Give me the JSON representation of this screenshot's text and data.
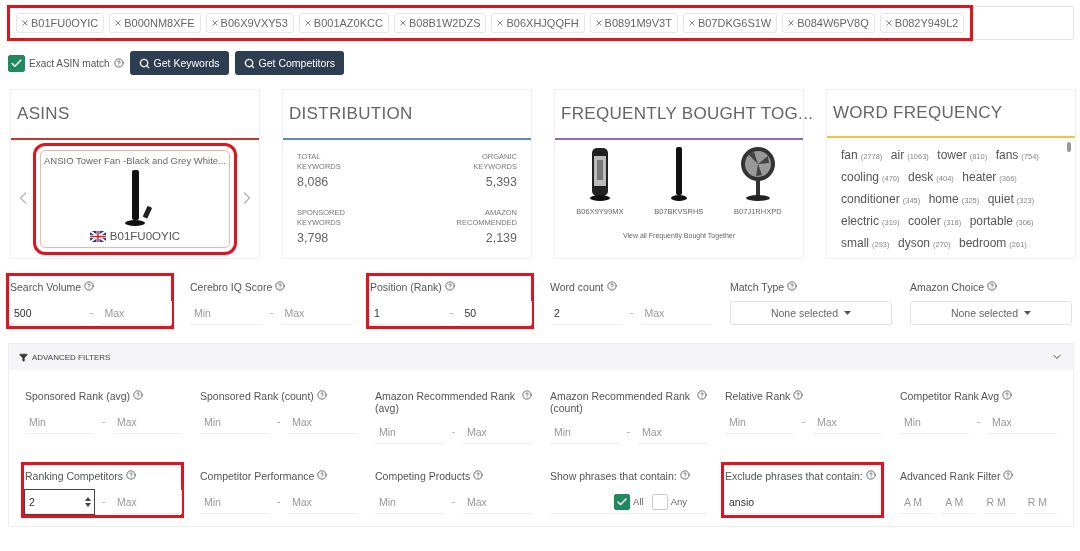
{
  "asin_tags": {
    "highlighted": true,
    "tags": [
      "B01FU0OYIC",
      "B000NM8XFE",
      "B06X9VXY53",
      "B001AZ0KCC",
      "B08B1W2DZS",
      "B06XHJQQFH",
      "B0891M9V3T",
      "B07DKG6S1W",
      "B084W6PV8Q",
      "B082Y949L2"
    ]
  },
  "exact_match": {
    "label": "Exact ASIN match",
    "checked": true
  },
  "buttons": [
    "Get Keywords",
    "Get Competitors"
  ],
  "cards": [
    {
      "kind": "asins",
      "title": "ASINS",
      "color": "#c0392b",
      "product": {
        "name": "ANSIO Tower Fan -Black and Grey White...",
        "asin": "B01FU0OYIC",
        "highlighted": true
      }
    },
    {
      "kind": "distribution",
      "title": "DISTRIBUTION",
      "color": "#5b8db8",
      "stats": [
        {
          "label": "TOTAL KEYWORDS",
          "value": "8,086"
        },
        {
          "label": "ORGANIC KEYWORDS",
          "value": "5,393"
        },
        {
          "label": "SPONSORED KEYWORDS",
          "value": "3,798"
        },
        {
          "label": "AMAZON RECOMMENDED",
          "value": "2,139"
        }
      ]
    },
    {
      "kind": "bought",
      "title": "FREQUENTLY BOUGHT TOG...",
      "color": "#8e6bb5",
      "products": [
        {
          "asin": "B06X9Y99MX",
          "kind": "heater"
        },
        {
          "asin": "B07BKVSRHS",
          "kind": "tower"
        },
        {
          "asin": "B07J1RHXPD",
          "kind": "desk-fan"
        }
      ],
      "link": "View all Frequently Bought Together"
    },
    {
      "kind": "words",
      "title": "WORD FREQUENCY",
      "color": "#f0c43c",
      "words": [
        {
          "word": "fan",
          "count": "(2778)"
        },
        {
          "word": "air",
          "count": "(1063)"
        },
        {
          "word": "tower",
          "count": "(810)"
        },
        {
          "word": "fans",
          "count": "(754)"
        },
        {
          "word": "cooling",
          "count": "(470)"
        },
        {
          "word": "desk",
          "count": "(404)"
        },
        {
          "word": "heater",
          "count": "(366)"
        },
        {
          "word": "conditioner",
          "count": "(345)"
        },
        {
          "word": "home",
          "count": "(325)"
        },
        {
          "word": "quiet",
          "count": "(323)"
        },
        {
          "word": "electric",
          "count": "(319)"
        },
        {
          "word": "cooler",
          "count": "(318)"
        },
        {
          "word": "portable",
          "count": "(306)"
        },
        {
          "word": "small",
          "count": "(293)"
        },
        {
          "word": "dyson",
          "count": "(270)"
        },
        {
          "word": "bedroom",
          "count": "(261)"
        }
      ]
    }
  ],
  "filters": [
    {
      "kind": "range",
      "label": "Search Volume",
      "highlighted": true,
      "inputs": [
        {
          "value": "500"
        },
        {
          "placeholder": "Max"
        }
      ]
    },
    {
      "kind": "range",
      "label": "Cerebro IQ Score",
      "highlighted": false,
      "inputs": [
        {
          "placeholder": "Min"
        },
        {
          "placeholder": "Max"
        }
      ]
    },
    {
      "kind": "range",
      "label": "Position (Rank)",
      "highlighted": true,
      "inputs": [
        {
          "value": "1"
        },
        {
          "value": "50"
        }
      ]
    },
    {
      "kind": "range",
      "label": "Word count",
      "highlighted": false,
      "inputs": [
        {
          "value": "2"
        },
        {
          "placeholder": "Max"
        }
      ]
    },
    {
      "kind": "select",
      "label": "Match Type",
      "highlighted": false,
      "value": "None selected"
    },
    {
      "kind": "select",
      "label": "Amazon Choice",
      "highlighted": false,
      "value": "None selected"
    }
  ],
  "advanced": {
    "label": "ADVANCED FILTERS",
    "expanded": true,
    "filters": [
      {
        "kind": "range",
        "label": "Sponsored Rank (avg)",
        "highlighted": false,
        "inputs": [
          {
            "placeholder": "Min"
          },
          {
            "placeholder": "Max"
          }
        ]
      },
      {
        "kind": "range",
        "label": "Sponsored Rank (count)",
        "highlighted": false,
        "inputs": [
          {
            "placeholder": "Min"
          },
          {
            "placeholder": "Max"
          }
        ]
      },
      {
        "kind": "range",
        "label": "Amazon Recommended Rank (avg)",
        "highlighted": false,
        "inputs": [
          {
            "placeholder": "Min"
          },
          {
            "placeholder": "Max"
          }
        ]
      },
      {
        "kind": "range",
        "label": "Amazon Recommended Rank (count)",
        "highlighted": false,
        "inputs": [
          {
            "placeholder": "Min"
          },
          {
            "placeholder": "Max"
          }
        ]
      },
      {
        "kind": "range",
        "label": "Relative Rank",
        "highlighted": false,
        "inputs": [
          {
            "placeholder": "Min"
          },
          {
            "placeholder": "Max"
          }
        ]
      },
      {
        "kind": "range",
        "label": "Competitor Rank Avg",
        "highlighted": false,
        "inputs": [
          {
            "placeholder": "Min"
          },
          {
            "placeholder": "Max"
          }
        ]
      },
      {
        "kind": "range",
        "label": "Ranking Competitors",
        "highlighted": true,
        "inputs": [
          {
            "value": "2",
            "spinner": true
          },
          {
            "placeholder": "Max"
          }
        ]
      },
      {
        "kind": "range",
        "label": "Competitor Performance",
        "highlighted": false,
        "inputs": [
          {
            "placeholder": "Min"
          },
          {
            "placeholder": "Max"
          }
        ]
      },
      {
        "kind": "range",
        "label": "Competing Products",
        "highlighted": false,
        "inputs": [
          {
            "placeholder": "Min"
          },
          {
            "placeholder": "Max"
          }
        ]
      },
      {
        "kind": "checks",
        "label": "Show phrases that contain:",
        "highlighted": false,
        "options": [
          {
            "label": "All",
            "checked": true
          },
          {
            "label": "Any",
            "checked": false
          }
        ]
      },
      {
        "kind": "text",
        "label": "Exclude phrases that contain:",
        "highlighted": true,
        "value": "ansio"
      },
      {
        "kind": "quad",
        "label": "Advanced Rank Filter",
        "highlighted": false,
        "inputs": [
          {
            "placeholder": "A M"
          },
          {
            "placeholder": "A M"
          },
          {
            "placeholder": "R M"
          },
          {
            "placeholder": "R M"
          }
        ]
      }
    ]
  }
}
